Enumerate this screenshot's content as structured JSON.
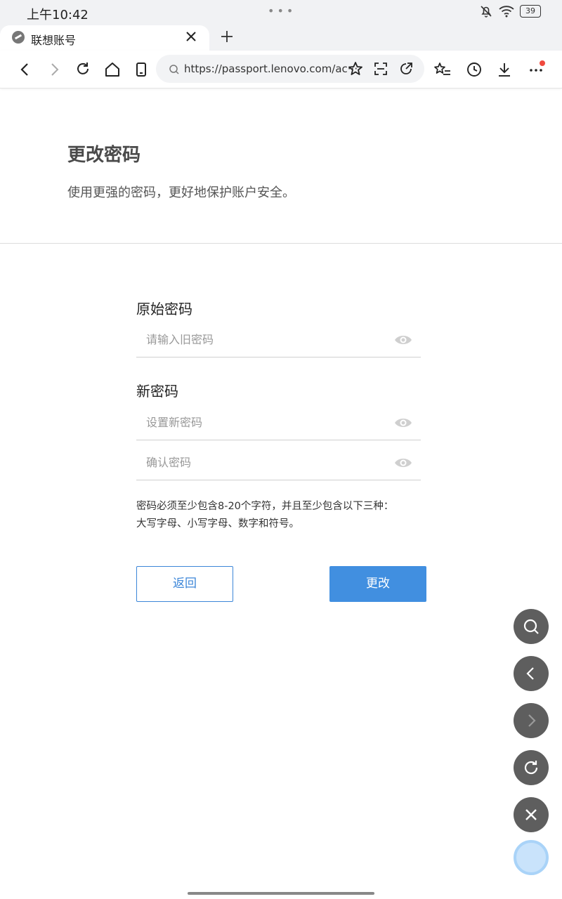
{
  "status_bar": {
    "time": "上午10:42",
    "battery": "39",
    "dots": "•••"
  },
  "browser": {
    "tab_title": "联想账号",
    "url": "https://passport.lenovo.com/ac···"
  },
  "page": {
    "title": "更改密码",
    "subtitle": "使用更强的密码，更好地保护账户安全。"
  },
  "form": {
    "old_password": {
      "label": "原始密码",
      "placeholder": "请输入旧密码",
      "value": ""
    },
    "new_password": {
      "label": "新密码",
      "placeholder": "设置新密码",
      "value": ""
    },
    "confirm_password": {
      "placeholder": "确认密码",
      "value": ""
    },
    "hint_line1": "密码必须至少包含8-20个字符，并且至少包含以下三种：",
    "hint_line2": "大写字母、小写字母、数字和符号。",
    "back_label": "返回",
    "submit_label": "更改"
  },
  "colors": {
    "accent": "#418fe0",
    "fab": "#5e5e5e"
  },
  "icons": {
    "floating": [
      "search-icon",
      "back-icon",
      "forward-icon",
      "refresh-icon",
      "close-icon",
      "assistant-bubble-icon"
    ]
  }
}
